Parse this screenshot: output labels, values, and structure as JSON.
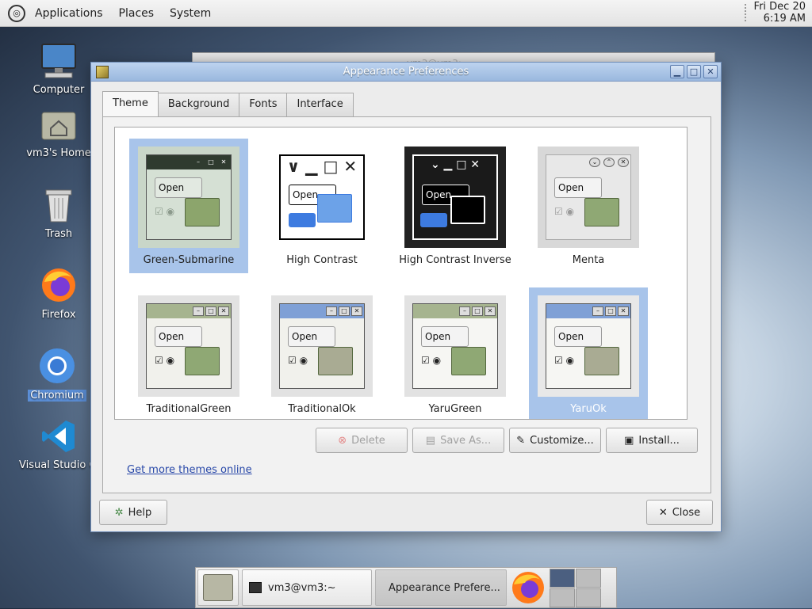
{
  "top_panel": {
    "menu": [
      "Applications",
      "Places",
      "System"
    ],
    "clock_date": "Fri Dec 20",
    "clock_time": "6:19 AM"
  },
  "desktop_icons": [
    {
      "label": "Computer"
    },
    {
      "label": "vm3's Home"
    },
    {
      "label": "Trash"
    },
    {
      "label": "Firefox"
    },
    {
      "label": "Chromium"
    },
    {
      "label": "Visual Studio Code"
    }
  ],
  "background_window": {
    "title": "vm3@vm3:~"
  },
  "window": {
    "title": "Appearance Preferences",
    "tabs": [
      "Theme",
      "Background",
      "Fonts",
      "Interface"
    ],
    "themes": [
      {
        "name": "Green-Submarine",
        "selected": true
      },
      {
        "name": "High Contrast",
        "selected": false
      },
      {
        "name": "High Contrast Inverse",
        "selected": false
      },
      {
        "name": "Menta",
        "selected": false
      },
      {
        "name": "TraditionalGreen",
        "selected": false
      },
      {
        "name": "TraditionalOk",
        "selected": false
      },
      {
        "name": "YaruGreen",
        "selected": false
      },
      {
        "name": "YaruOk",
        "selected": true
      }
    ],
    "thumb_open_label": "Open",
    "actions": {
      "delete": "Delete",
      "save_as": "Save As...",
      "customize": "Customize...",
      "install": "Install..."
    },
    "more_themes_link": "Get more themes online",
    "help_button": "Help",
    "close_button": "Close"
  },
  "taskbar": {
    "tasks": [
      "vm3@vm3:~",
      "Appearance Prefere..."
    ]
  },
  "colors": {
    "selection": "#a8c4ea",
    "titlebar": "#9ab8de",
    "link": "#2747a8"
  }
}
